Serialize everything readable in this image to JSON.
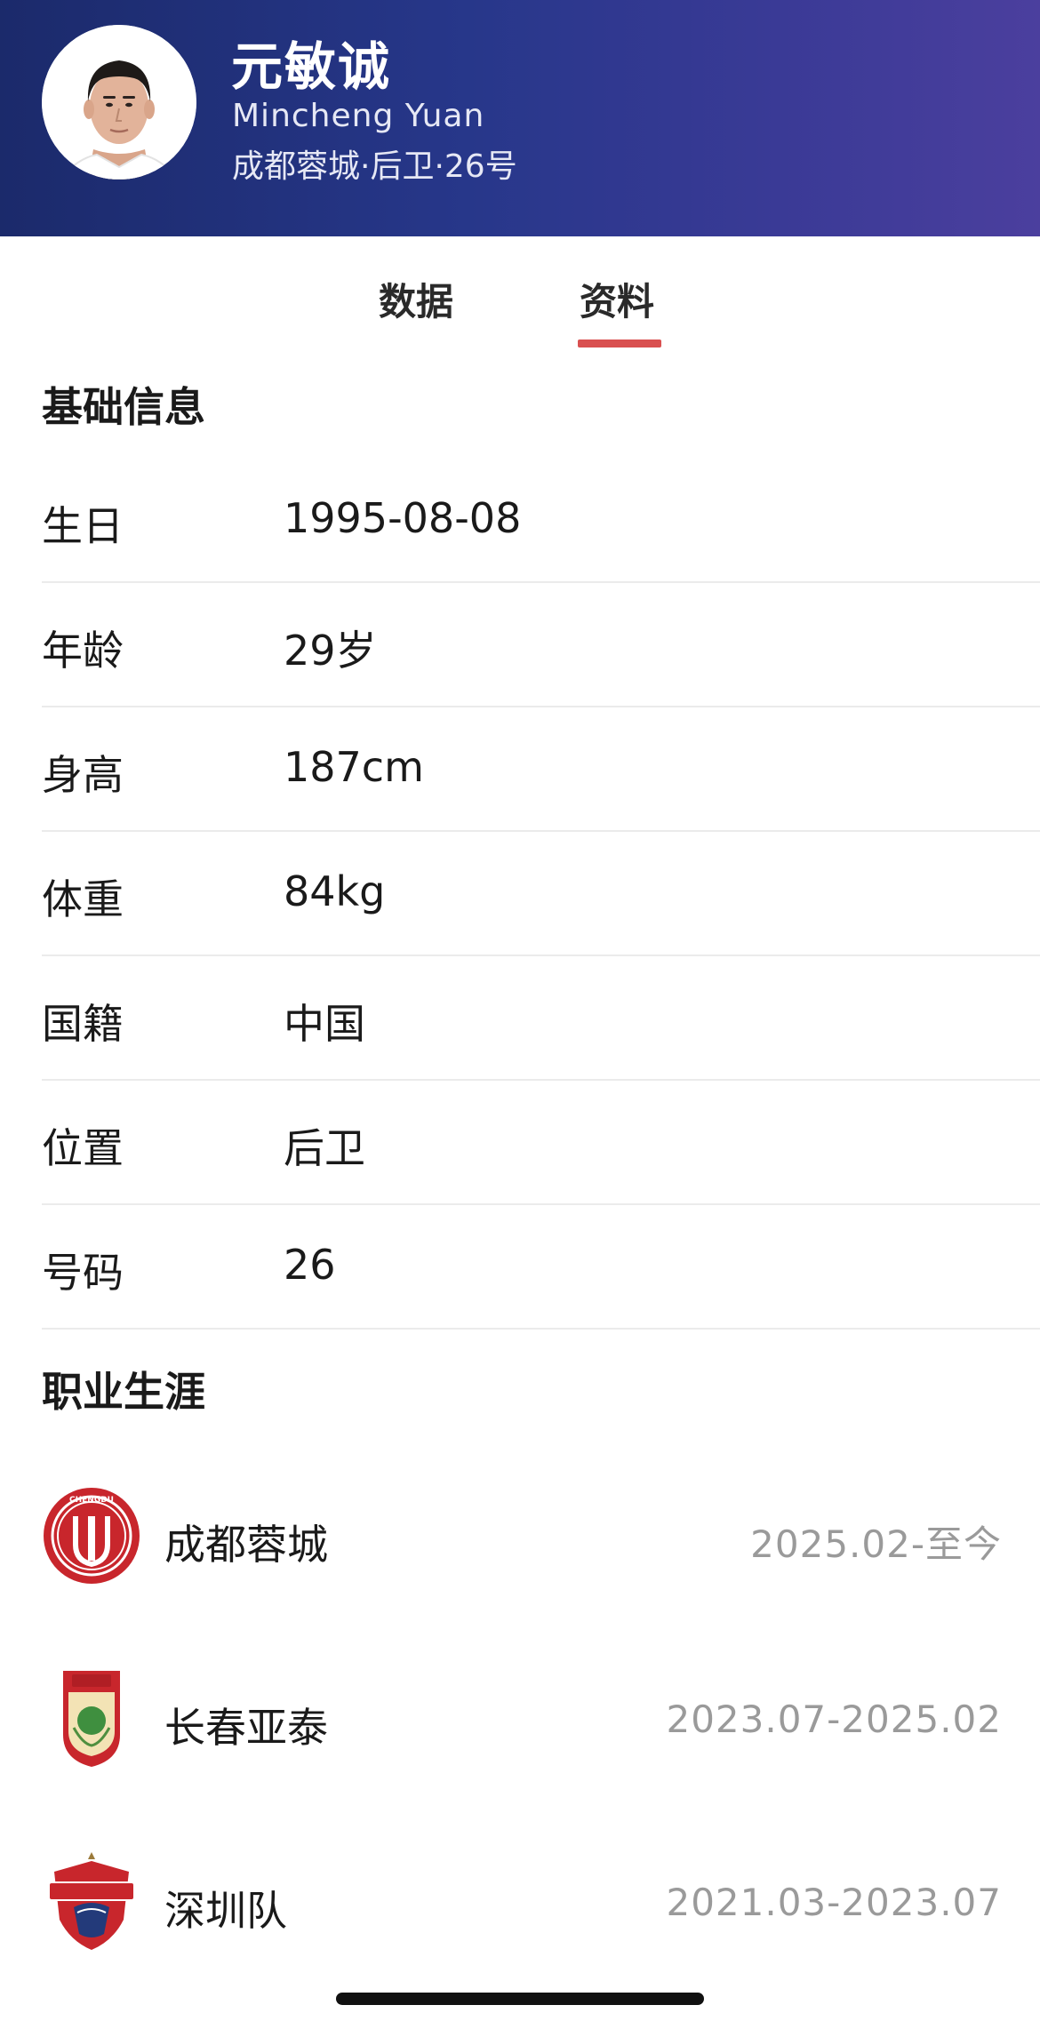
{
  "header": {
    "name": "元敏诚",
    "name_en": "Mincheng Yuan",
    "subtitle": "成都蓉城·后卫·26号"
  },
  "tabs": [
    {
      "label": "数据",
      "active": false
    },
    {
      "label": "资料",
      "active": true
    }
  ],
  "basic_info": {
    "title": "基础信息",
    "rows": [
      {
        "label": "生日",
        "value": "1995-08-08"
      },
      {
        "label": "年龄",
        "value": "29岁"
      },
      {
        "label": "身高",
        "value": "187cm"
      },
      {
        "label": "体重",
        "value": "84kg"
      },
      {
        "label": "国籍",
        "value": "中国"
      },
      {
        "label": "位置",
        "value": "后卫"
      },
      {
        "label": "号码",
        "value": "26"
      }
    ]
  },
  "career": {
    "title": "职业生涯",
    "items": [
      {
        "club": "成都蓉城",
        "period": "2025.02-至今",
        "logo_icon": "chengdu-rongcheng-logo-icon"
      },
      {
        "club": "长春亚泰",
        "period": "2023.07-2025.02",
        "logo_icon": "changchun-yatai-logo-icon"
      },
      {
        "club": "深圳队",
        "period": "2021.03-2023.07",
        "logo_icon": "shenzhen-fc-logo-icon"
      }
    ]
  },
  "colors": {
    "header_start": "#1b2a6b",
    "header_end": "#4b3f9e",
    "tab_accent": "#d95050",
    "muted_text": "#9a9a9a"
  }
}
